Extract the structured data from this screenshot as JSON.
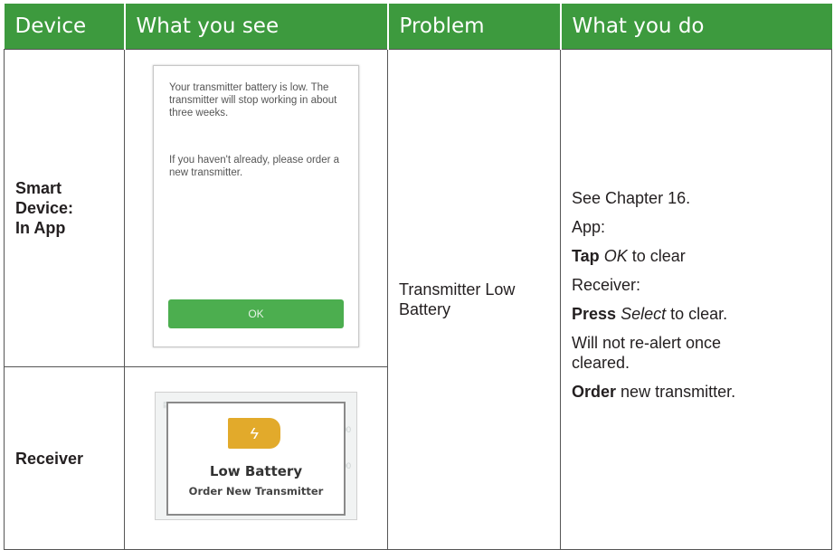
{
  "headers": {
    "device": "Device",
    "what_you_see": "What you see",
    "problem": "Problem",
    "what_you_do": "What you do"
  },
  "rows": {
    "smart_device": {
      "device_label_lines": [
        "Smart",
        "Device:",
        "In App"
      ],
      "screen": {
        "message_1": "Your transmitter battery is low. The transmitter will stop working in about three weeks.",
        "message_2": "If you haven't already, please order a new transmitter.",
        "button": "OK"
      }
    },
    "receiver": {
      "device_label": "Receiver",
      "screen": {
        "icon": "battery-low-icon",
        "title": "Low Battery",
        "subtitle": "Order New Transmitter"
      }
    }
  },
  "problem": {
    "line_1": "Transmitter Low",
    "line_2": "Battery"
  },
  "action": {
    "see_chapter": "See Chapter 16.",
    "app_label": "App:",
    "tap_verb": "Tap",
    "tap_target": "OK",
    "tap_rest": "to clear",
    "receiver_label": "Receiver:",
    "press_verb": "Press",
    "press_target": "Select",
    "press_rest": "to clear.",
    "no_realert": "Will not re-alert once cleared.",
    "order_verb": "Order",
    "order_rest": "new transmitter."
  },
  "colors": {
    "header_bg": "#3d9a3e",
    "ok_button": "#4cae4f",
    "battery_icon": "#e2aa2b"
  }
}
